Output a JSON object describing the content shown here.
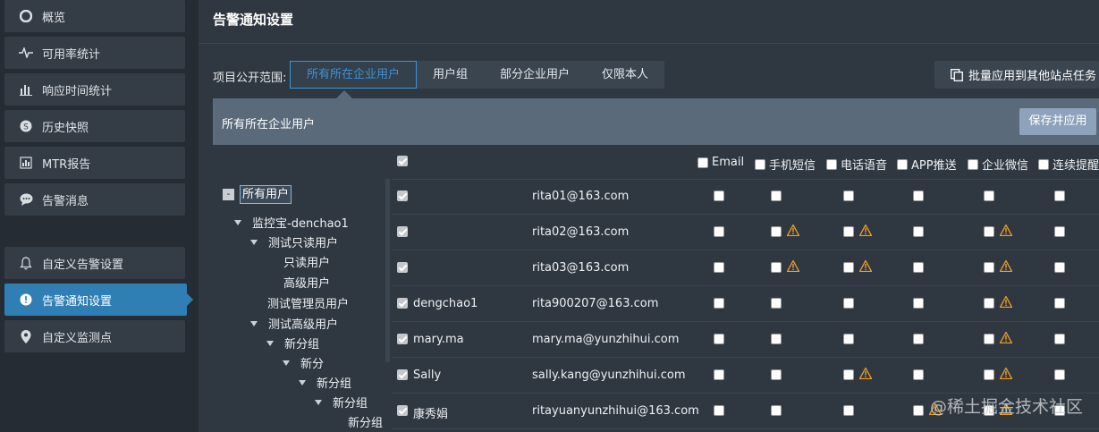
{
  "sidebar": {
    "items": [
      {
        "label": "概览",
        "icon": "overview-icon"
      },
      {
        "label": "可用率统计",
        "icon": "pulse-icon"
      },
      {
        "label": "响应时间统计",
        "icon": "bar-chart-icon"
      },
      {
        "label": "历史快照",
        "icon": "snapshot-icon"
      },
      {
        "label": "MTR报告",
        "icon": "report-icon"
      },
      {
        "label": "告警消息",
        "icon": "chat-icon"
      },
      {
        "label": "自定义告警设置",
        "icon": "bell-icon"
      },
      {
        "label": "告警通知设置",
        "icon": "notify-icon",
        "active": true
      },
      {
        "label": "自定义监测点",
        "icon": "location-icon"
      }
    ]
  },
  "header": {
    "title": "告警通知设置"
  },
  "scope": {
    "label": "项目公开范围:",
    "tabs": [
      "所有所在企业用户",
      "用户组",
      "部分企业用户",
      "仅限本人"
    ],
    "active_tab": "所有所在企业用户",
    "batch_label": "批量应用到其他站点任务",
    "bar_title": "所有所在企业用户",
    "save_label": "保存并应用"
  },
  "tree": {
    "root": "所有用户",
    "nodes": [
      "监控宝-denchao1",
      "测试只读用户",
      "只读用户",
      "高级用户",
      "测试管理员用户",
      "测试高级用户",
      "新分组",
      "新分",
      "新分组",
      "新分组",
      "新分组"
    ]
  },
  "table": {
    "columns": [
      "Email",
      "手机短信",
      "电话语音",
      "APP推送",
      "企业微信",
      "连续提醒"
    ],
    "rows": [
      {
        "name": "",
        "email": "rita01@163.com"
      },
      {
        "name": "",
        "email": "rita02@163.com"
      },
      {
        "name": "",
        "email": "rita03@163.com"
      },
      {
        "name": "dengchao1",
        "email": "rita900207@163.com"
      },
      {
        "name": "mary.ma",
        "email": "mary.ma@yunzhihui.com"
      },
      {
        "name": "Sally",
        "email": "sally.kang@yunzhihui.com"
      },
      {
        "name": "康秀娟",
        "email": "ritayuanyunzhihui@163.com"
      }
    ]
  },
  "watermark": "@稀土掘金技术社区",
  "colors": {
    "accent": "#3b94d9",
    "active_nav": "#2f7fb5",
    "warning": "#f0a020"
  }
}
